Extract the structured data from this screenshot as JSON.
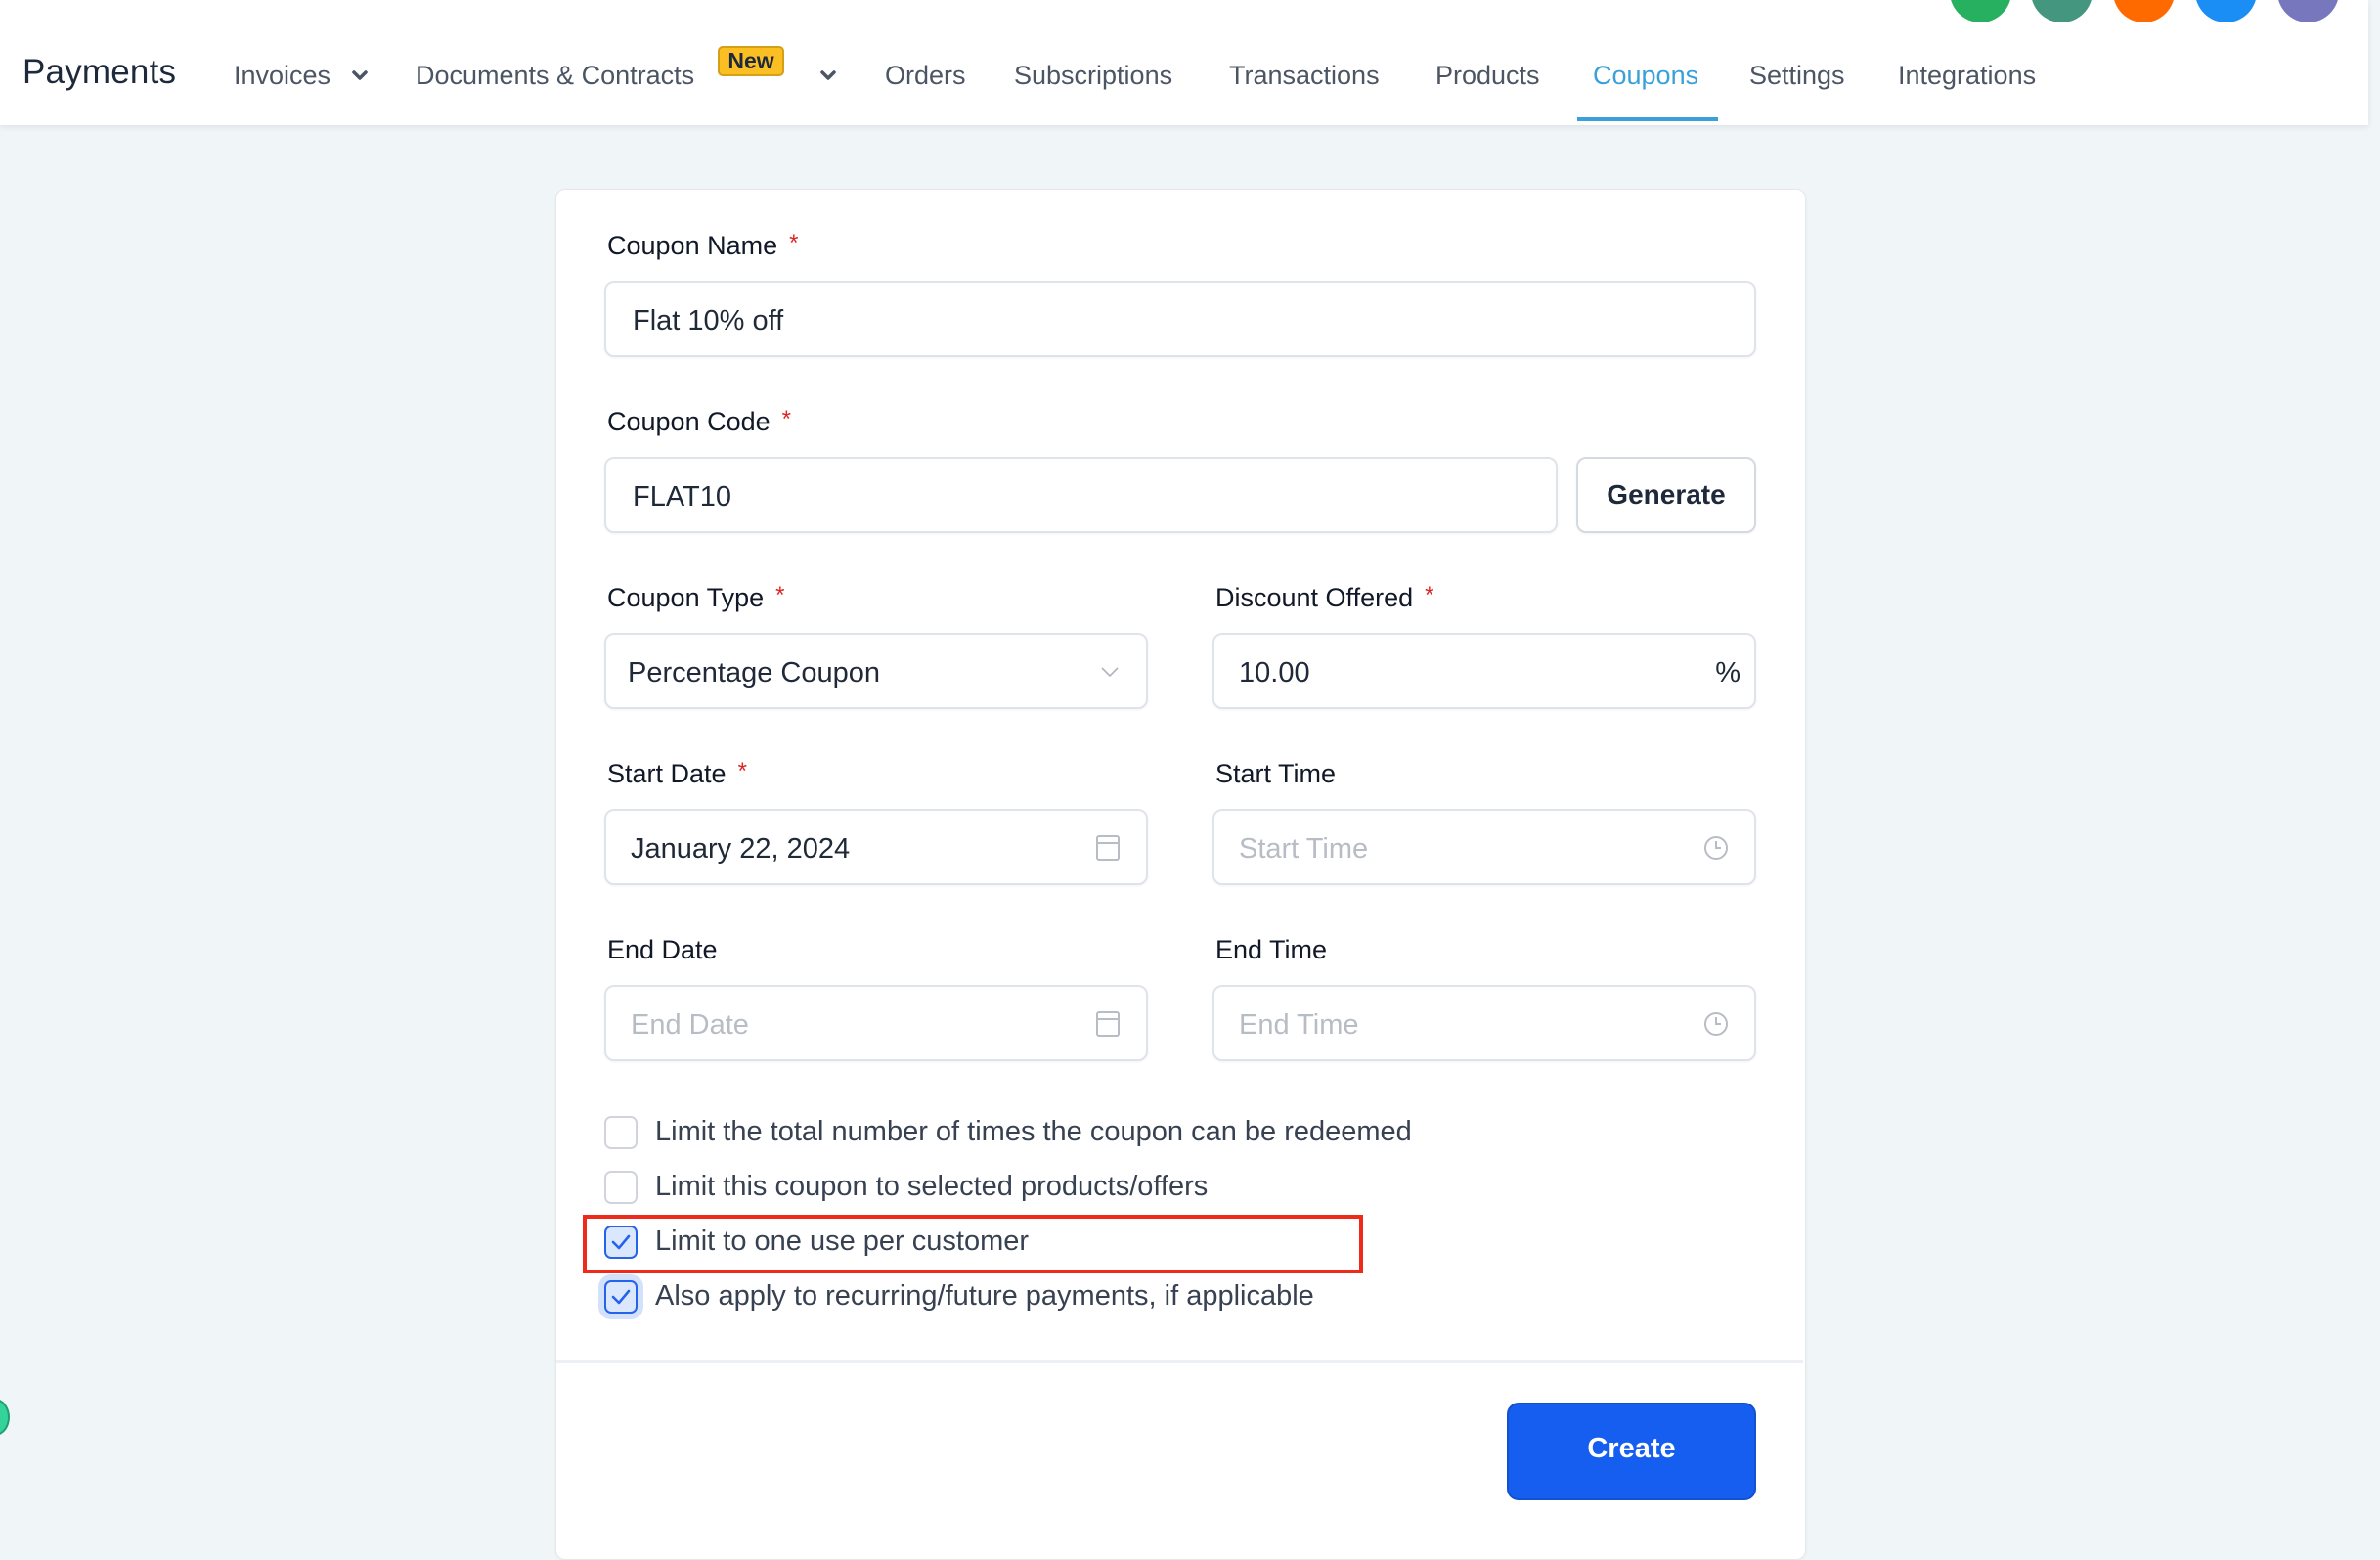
{
  "header": {
    "app_title": "Payments",
    "nav": [
      {
        "label": "Invoices",
        "has_dropdown": true
      },
      {
        "label": "Documents & Contracts",
        "badge": "New",
        "has_dropdown": true
      },
      {
        "label": "Orders"
      },
      {
        "label": "Subscriptions"
      },
      {
        "label": "Transactions"
      },
      {
        "label": "Products"
      },
      {
        "label": "Coupons",
        "active": true
      },
      {
        "label": "Settings"
      },
      {
        "label": "Integrations"
      }
    ],
    "top_icons": [
      {
        "name": "phone-icon",
        "color": "#27b060"
      },
      {
        "name": "megaphone-icon",
        "color": "#45967e"
      },
      {
        "name": "bell-icon",
        "color": "#ff6a00"
      },
      {
        "name": "help-icon",
        "color": "#1b8ef5"
      },
      {
        "name": "user-avatar",
        "color": "#7677bd"
      }
    ],
    "accent_color": "#3aa0da"
  },
  "form": {
    "coupon_name": {
      "label": "Coupon Name",
      "required": "*",
      "value": "Flat 10% off"
    },
    "coupon_code": {
      "label": "Coupon Code",
      "required": "*",
      "value": "FLAT10",
      "generate_label": "Generate"
    },
    "coupon_type": {
      "label": "Coupon Type",
      "required": "*",
      "value": "Percentage Coupon"
    },
    "discount_offered": {
      "label": "Discount Offered",
      "required": "*",
      "value": "10.00",
      "suffix": "%"
    },
    "start_date": {
      "label": "Start Date",
      "required": "*",
      "value": "January 22, 2024"
    },
    "start_time": {
      "label": "Start Time",
      "placeholder": "Start Time"
    },
    "end_date": {
      "label": "End Date",
      "placeholder": "End Date"
    },
    "end_time": {
      "label": "End Time",
      "placeholder": "End Time"
    },
    "options": [
      {
        "label": "Limit the total number of times the coupon can be redeemed",
        "checked": false
      },
      {
        "label": "Limit this coupon to selected products/offers",
        "checked": false
      },
      {
        "label": "Limit to one use per customer",
        "checked": true,
        "highlighted": true
      },
      {
        "label": "Also apply to recurring/future payments, if applicable",
        "checked": true
      }
    ],
    "create_label": "Create",
    "primary_color": "#155eef"
  }
}
